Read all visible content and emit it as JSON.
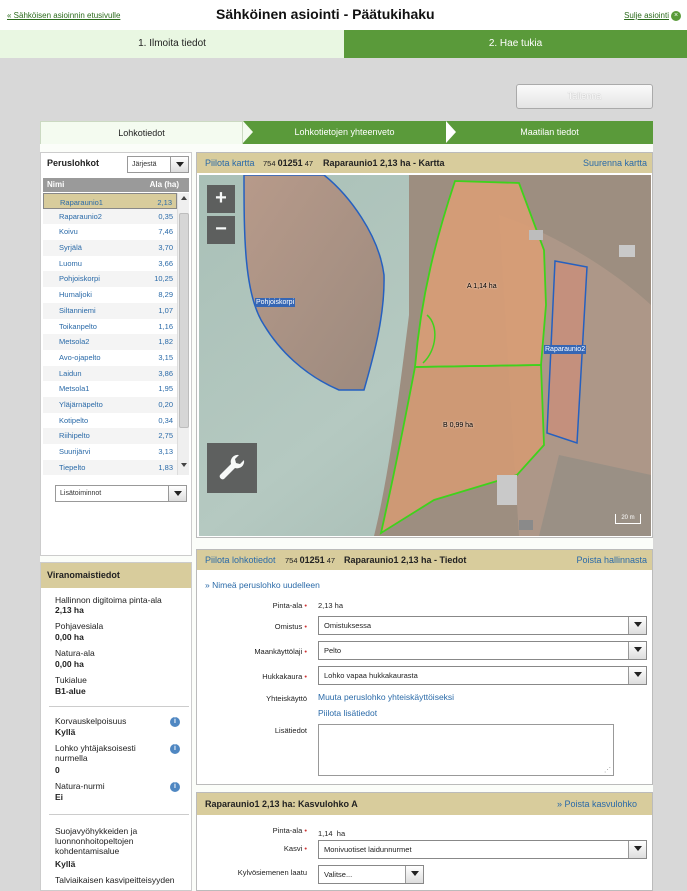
{
  "header": {
    "back_link": "« Sähköisen asioinnin etusivulle",
    "title": "Sähköinen asiointi  -  Päätukihaku",
    "close_link": "Sulje asiointi"
  },
  "steps": [
    {
      "label": "1. Ilmoita tiedot"
    },
    {
      "label": "2. Hae tukia"
    }
  ],
  "save_button": "Tallenna",
  "tabs": [
    {
      "label": "Lohkotiedot"
    },
    {
      "label": "Lohkotietojen yhteenveto"
    },
    {
      "label": "Maatilan tiedot"
    }
  ],
  "left": {
    "title": "Peruslohkot",
    "sort_label": "Järjestä",
    "col_name": "Nimi",
    "col_area": "Ala (ha)",
    "parcels": [
      {
        "name": "Raparaunio1",
        "area": "2,13"
      },
      {
        "name": "Raparaunio2",
        "area": "0,35"
      },
      {
        "name": "Koivu",
        "area": "7,46"
      },
      {
        "name": "Syrjälä",
        "area": "3,70"
      },
      {
        "name": "Luomu",
        "area": "3,66"
      },
      {
        "name": "Pohjoiskorpi",
        "area": "10,25"
      },
      {
        "name": "Humaljoki",
        "area": "8,29"
      },
      {
        "name": "Siltanniemi",
        "area": "1,07"
      },
      {
        "name": "Toikanpelto",
        "area": "1,16"
      },
      {
        "name": "Metsola2",
        "area": "1,82"
      },
      {
        "name": "Avo-ojapelto",
        "area": "3,15"
      },
      {
        "name": "Laidun",
        "area": "3,86"
      },
      {
        "name": "Metsola1",
        "area": "1,95"
      },
      {
        "name": "Yläjärnäpelto",
        "area": "0,20"
      },
      {
        "name": "Kotipelto",
        "area": "0,34"
      },
      {
        "name": "Riihipelto",
        "area": "2,75"
      },
      {
        "name": "Suurijärvi",
        "area": "3,13"
      },
      {
        "name": "Tiepelto",
        "area": "1,83"
      }
    ],
    "more_label": "Lisätoiminnot"
  },
  "authority": {
    "title": "Viranomaistiedot",
    "g1": [
      {
        "label": "Hallinnon digitoima pinta-ala",
        "value": "2,13 ha"
      },
      {
        "label": "Pohjavesiala",
        "value": "0,00 ha"
      },
      {
        "label": "Natura-ala",
        "value": "0,00 ha"
      },
      {
        "label": "Tukialue",
        "value": "B1-alue"
      }
    ],
    "g2": [
      {
        "label": "Korvauskelpoisuus",
        "value": "Kyllä"
      },
      {
        "label": "Lohko yhtäjaksoisesti nurmella",
        "value": "0"
      },
      {
        "label": "Natura-nurmi",
        "value": "Ei"
      }
    ],
    "g3_label": "Suojavyöhykkeiden ja luonnonhoitopeltojen kohdentamisalue",
    "g3_value": "Kyllä",
    "g4_label": "Talviaikaisen kasvipeitteisyyden"
  },
  "map": {
    "hide_link": "Piilota kartta",
    "code1": "754",
    "code2": "01251",
    "code3": "47",
    "title": "Raparaunio1 2,13 ha - Kartta",
    "enlarge": "Suurenna kartta",
    "labels": {
      "pohjoiskorpi": "Pohjoiskorpi",
      "a": "A 1,14 ha",
      "b": "B 0,99 ha",
      "rap2": "Raparaunio2"
    },
    "scale": "20 m"
  },
  "details": {
    "hide_link": "Piilota lohkotiedot",
    "code1": "754",
    "code2": "01251",
    "code3": "47",
    "title": "Raparaunio1 2,13 ha - Tiedot",
    "remove_link": "Poista hallinnasta",
    "rename_link": "» Nimeä peruslohko uudelleen",
    "area_label": "Pinta-ala",
    "area_value": "2,13 ha",
    "owner_label": "Omistus",
    "owner_value": "Omistuksessa",
    "use_label": "Maankäyttölaji",
    "use_value": "Pelto",
    "oat_label": "Hukkakaura",
    "oat_value": "Lohko vapaa hukkakaurasta",
    "shared_label": "Yhteiskäyttö",
    "shared_link": "Muuta peruslohko yhteiskäyttöiseksi",
    "hide_more": "Piilota lisätiedot",
    "notes_label": "Lisätiedot"
  },
  "crop": {
    "title": "Raparaunio1 2,13 ha: Kasvulohko A",
    "remove_link": "» Poista kasvulohko",
    "area_label": "Pinta-ala",
    "area_value": "1,14",
    "area_unit": "ha",
    "crop_label": "Kasvi",
    "crop_value": "Monivuotiset laidunnurmet",
    "seed_label": "Kylvösiemenen laatu",
    "seed_value": "Valitse..."
  },
  "colors": {
    "accent": "#5a9a3a",
    "panel_header": "#d8cc9c",
    "link": "#2a6aa8"
  }
}
